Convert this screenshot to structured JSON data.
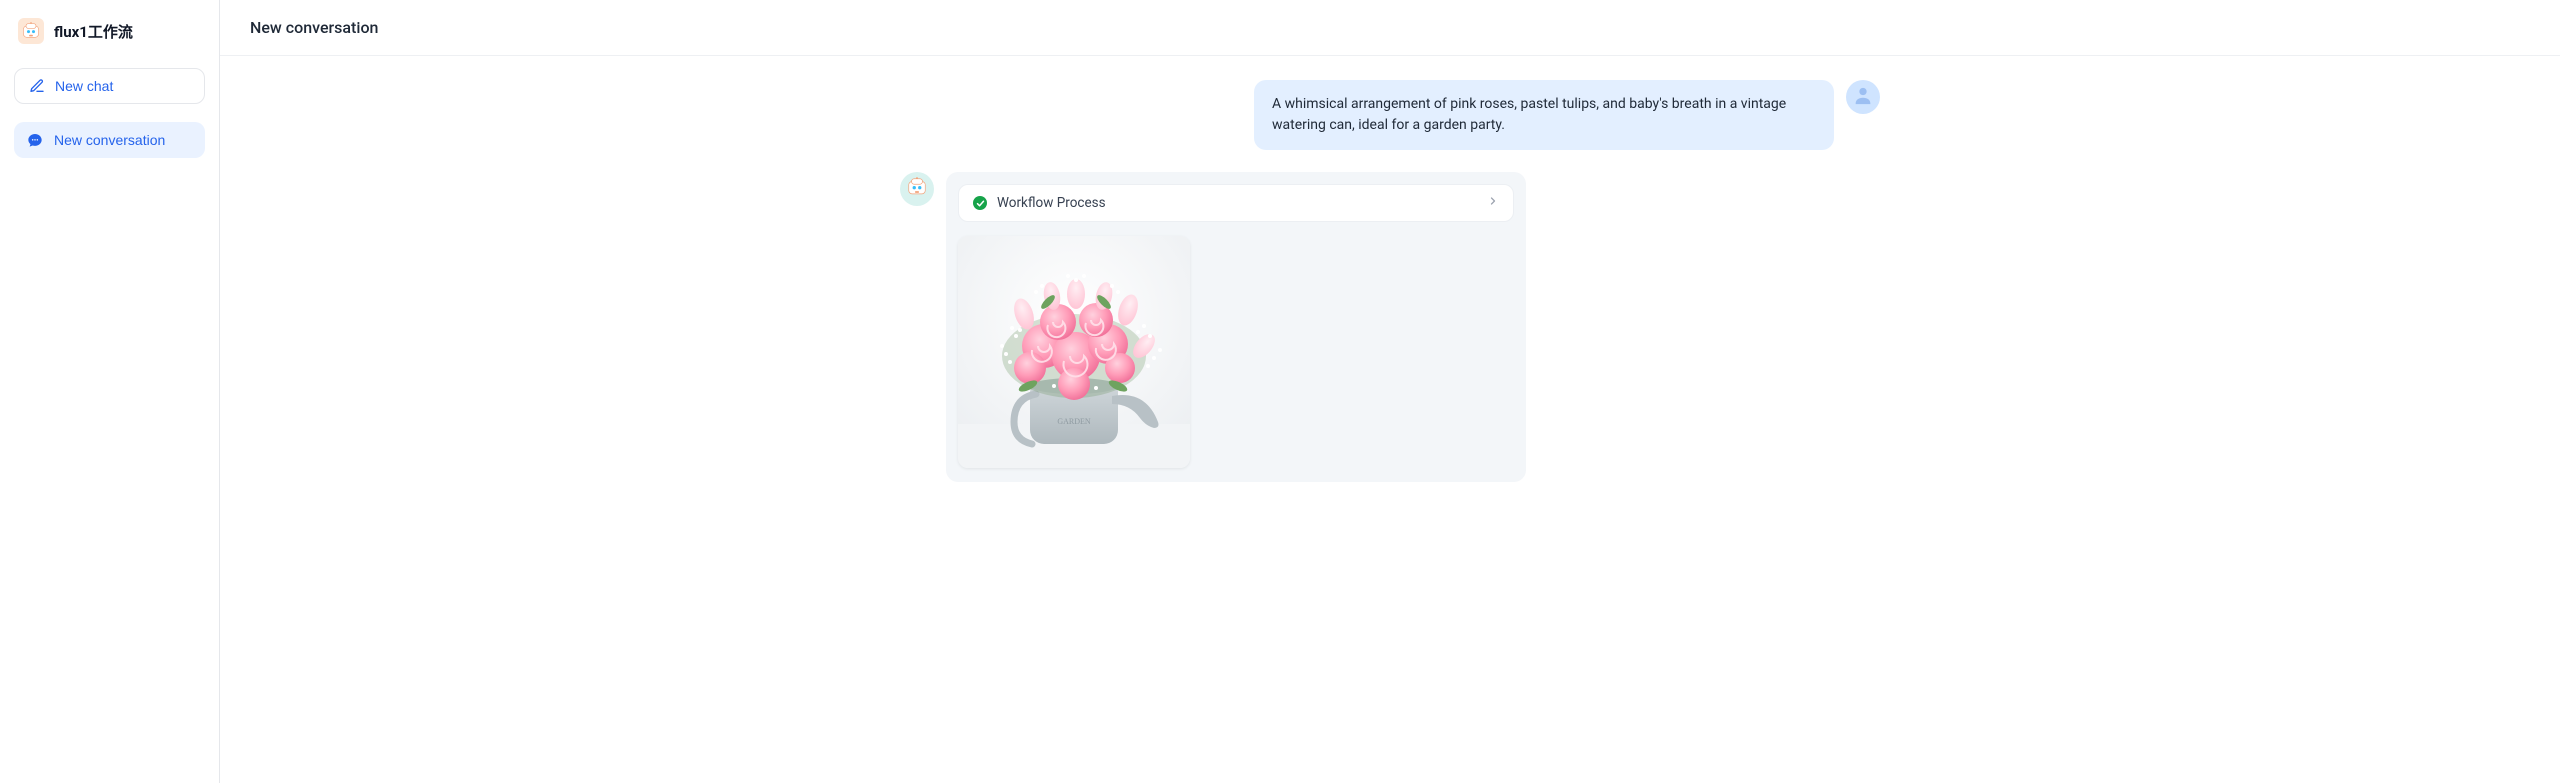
{
  "app": {
    "name": "flux1工作流",
    "logo_icon": "bot-icon"
  },
  "sidebar": {
    "new_chat_label": "New chat",
    "conversations": [
      {
        "id": "c1",
        "label": "New conversation",
        "active": true
      }
    ]
  },
  "header": {
    "title": "New conversation"
  },
  "chat": {
    "user_message": "A whimsical arrangement of pink roses, pastel tulips, and baby's breath in a vintage watering can, ideal for a garden party.",
    "user_avatar_icon": "user-icon",
    "assistant_avatar_icon": "bot-icon",
    "workflow": {
      "status_icon": "check-icon",
      "title": "Workflow Process",
      "expand_icon": "chevron-right-icon"
    },
    "generated_image_alt": "Pink rose and tulip bouquet in a vintage watering can"
  }
}
